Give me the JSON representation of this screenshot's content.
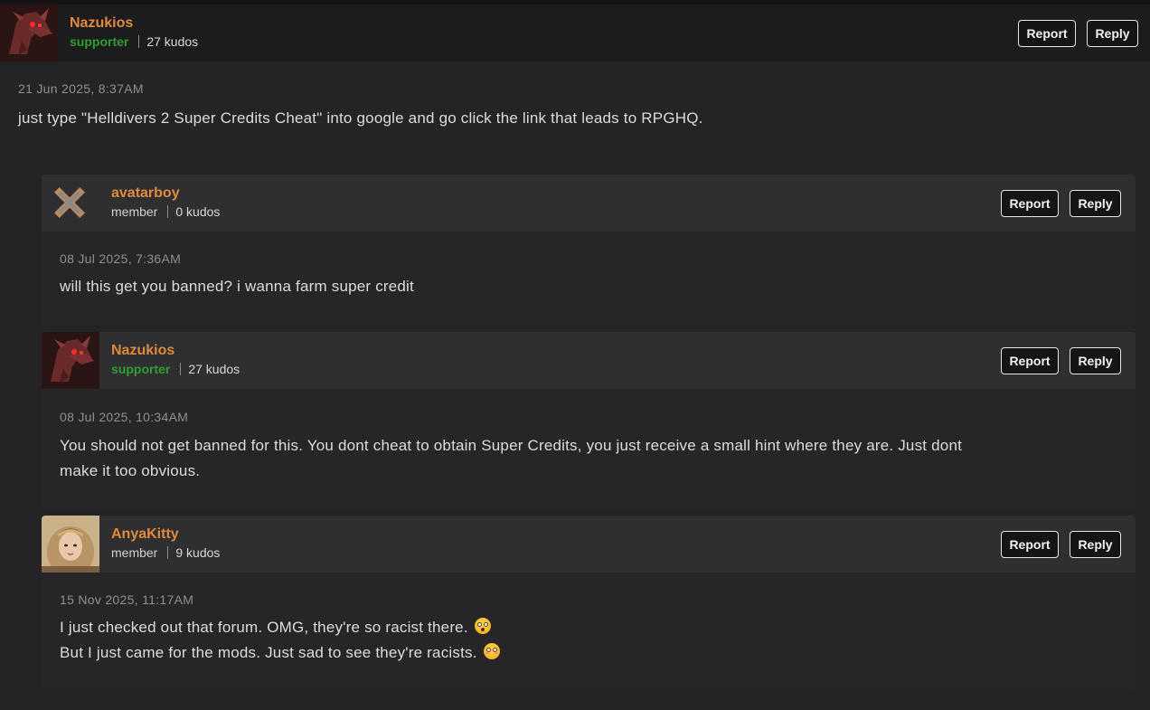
{
  "buttons": {
    "report_label": "Report",
    "reply_label": "Reply"
  },
  "comments": [
    {
      "username": "Nazukios",
      "role": "supporter",
      "kudos": "27 kudos",
      "date": "21 Jun 2025, 8:37AM",
      "lines": [
        "just type \"Helldivers 2 Super Credits Cheat\" into google and go click the link that leads to RPGHQ."
      ],
      "avatar_icon": "red-dragon-avatar"
    },
    {
      "username": "avatarboy",
      "role": "member",
      "kudos": "0 kudos",
      "date": "08 Jul 2025, 7:36AM",
      "lines": [
        "will this get you banned? i wanna farm super credit"
      ],
      "avatar_icon": "default-x-avatar"
    },
    {
      "username": "Nazukios",
      "role": "supporter",
      "kudos": "27 kudos",
      "date": "08 Jul 2025, 10:34AM",
      "lines": [
        "You should not get banned for this. You dont cheat to obtain Super Credits, you just receive a small hint where they are. Just dont",
        "make it too obvious."
      ],
      "avatar_icon": "red-dragon-avatar"
    },
    {
      "username": "AnyaKitty",
      "role": "member",
      "kudos": "9 kudos",
      "date": "15 Nov 2025, 11:17AM",
      "lines": [
        "I just checked out that forum. OMG, they're so racist there.",
        "But I just came for the mods. Just sad to see they're racists."
      ],
      "emojis": [
        "flushed-face-emoji",
        "pleading-face-emoji"
      ],
      "avatar_icon": "portrait-photo-avatar"
    }
  ],
  "colors": {
    "username": "#e08a3c",
    "supporter": "#2f9e2f",
    "background": "#181818",
    "card": "#262628",
    "header_reply": "#2f2f32"
  }
}
